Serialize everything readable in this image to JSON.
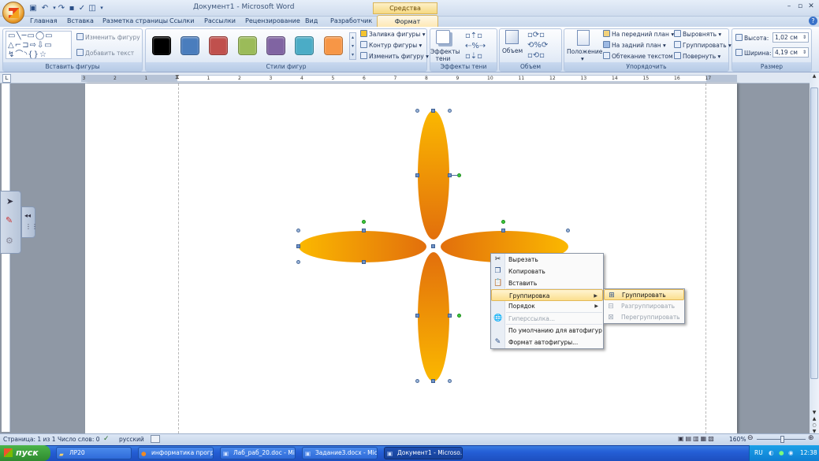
{
  "window": {
    "title_doc": "Документ1",
    "title_sep": " - ",
    "title_app": "Microsoft Word",
    "context_tools_label": "Средства рисования",
    "controls": [
      "–",
      "▫",
      "✕"
    ]
  },
  "tabs": [
    "Главная",
    "Вставка",
    "Разметка страницы",
    "Ссылки",
    "Рассылки",
    "Рецензирование",
    "Вид",
    "Разработчик"
  ],
  "active_tab": "Формат",
  "ribbon": {
    "insert_shapes": {
      "change_shape": "Изменить фигуру",
      "add_text": "Добавить текст",
      "label": "Вставить фигуры"
    },
    "shape_styles": {
      "swatches": [
        "#000000",
        "#4a7dbd",
        "#c0504d",
        "#9bbb59",
        "#8064a2",
        "#4bacc6",
        "#f79646"
      ],
      "fill": "Заливка фигуры",
      "outline": "Контур фигуры",
      "change": "Изменить фигуру",
      "label": "Стили фигур"
    },
    "shadow": {
      "button": "Эффекты тени",
      "label": "Эффекты тени"
    },
    "volume": {
      "button": "Объем",
      "label": "Объем"
    },
    "arrange": {
      "position": "Положение",
      "bring_front": "На передний план",
      "send_back": "На задний план",
      "wrap": "Обтекание текстом",
      "align": "Выровнять",
      "group": "Группировать",
      "rotate": "Повернуть",
      "label": "Упорядочить"
    },
    "size": {
      "height_label": "Высота:",
      "height": "1,02 см",
      "width_label": "Ширина:",
      "width": "4,19 см",
      "label": "Размер"
    }
  },
  "ruler": {
    "numbers": [
      "3",
      "2",
      "1",
      "1",
      "2",
      "3",
      "4",
      "5",
      "6",
      "7",
      "8",
      "9",
      "10",
      "11",
      "12",
      "13",
      "14",
      "15",
      "16",
      "17"
    ]
  },
  "context_menu": {
    "items": [
      {
        "label": "Вырезать",
        "icon": "scissors-icon",
        "enabled": true
      },
      {
        "label": "Копировать",
        "icon": "copy-icon",
        "enabled": true
      },
      {
        "label": "Вставить",
        "icon": "paste-icon",
        "enabled": true
      },
      {
        "label": "Группировка",
        "icon": "",
        "enabled": true,
        "submenu": true,
        "selected": true
      },
      {
        "label": "Порядок",
        "icon": "",
        "enabled": true,
        "submenu": true
      },
      {
        "label": "Гиперссылка...",
        "icon": "hyperlink-icon",
        "enabled": false
      },
      {
        "label": "По умолчанию для автофигур",
        "icon": "",
        "enabled": true
      },
      {
        "label": "Формат автофигуры...",
        "icon": "format-shape-icon",
        "enabled": true
      }
    ],
    "submenu": [
      {
        "label": "Группировать",
        "enabled": true,
        "selected": true
      },
      {
        "label": "Разгруппировать",
        "enabled": false
      },
      {
        "label": "Перегруппировать",
        "enabled": false
      }
    ]
  },
  "petal_colors": {
    "light": "#fbb800",
    "dark": "#e26f0c"
  },
  "status": {
    "page": "Страница: 1 из 1",
    "words": "Число слов: 0",
    "lang": "русский",
    "zoom": "160%"
  },
  "taskbar": {
    "start": "пуск",
    "tasks": [
      "ЛР20",
      "информатика прогр...",
      "Лаб_раб_20.doc - Mi...",
      "Задание3.docx - Mic...",
      "Документ1 - Microso..."
    ],
    "lang": "RU",
    "clock": "12:38"
  }
}
